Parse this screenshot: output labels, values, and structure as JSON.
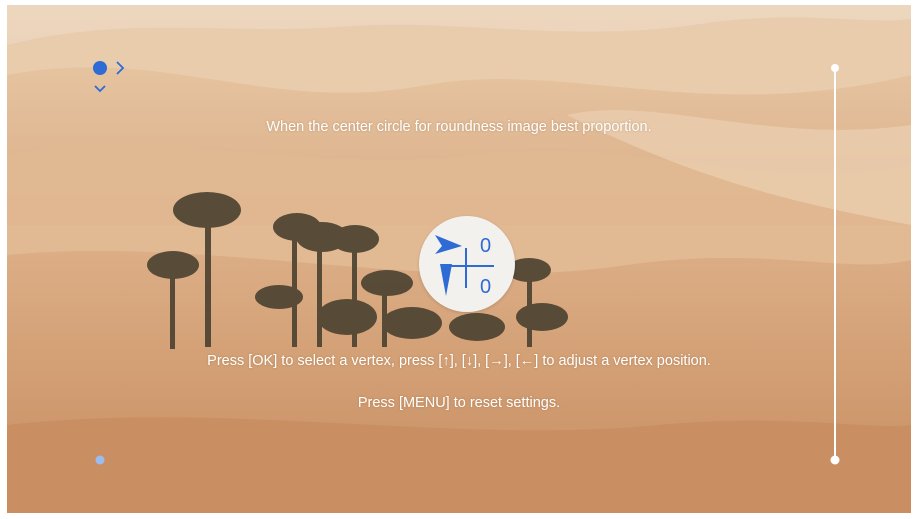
{
  "instructions": {
    "top": "When the center circle for roundness image best proportion.",
    "adjust": "Press [OK] to select a vertex, press [↑], [↓], [→], [←] to adjust a vertex position.",
    "reset": "Press [MENU] to reset settings."
  },
  "keystone": {
    "horizontal_value": "0",
    "vertical_value": "0"
  },
  "colors": {
    "accent": "#2f6bd4",
    "frame_line": "#ffffff"
  },
  "icons": [
    "selected-vertex-dot-icon",
    "right-chevron-icon",
    "down-chevron-icon",
    "horizontal-arrow-icon",
    "vertical-arrow-icon",
    "crosshair-icon"
  ]
}
